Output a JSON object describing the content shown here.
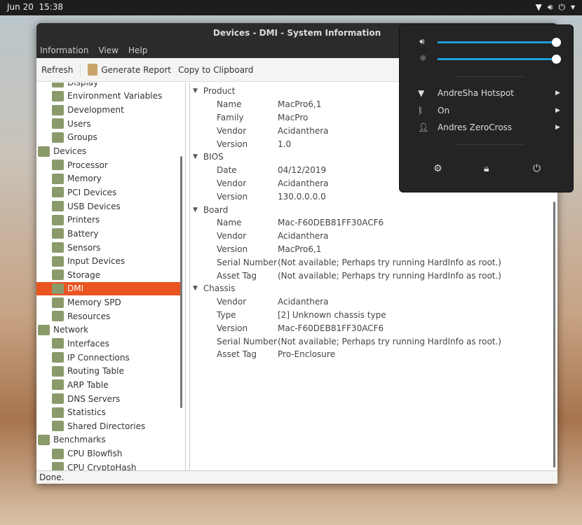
{
  "topbar": {
    "date": "Jun 20",
    "time": "15:38"
  },
  "window": {
    "title": "Devices - DMI - System Information"
  },
  "menu": [
    "Information",
    "View",
    "Help"
  ],
  "toolbar": {
    "refresh": "Refresh",
    "report": "Generate Report",
    "copy": "Copy to Clipboard"
  },
  "sidebar": [
    {
      "label": "Display",
      "cat": false
    },
    {
      "label": "Environment Variables",
      "cat": false
    },
    {
      "label": "Development",
      "cat": false
    },
    {
      "label": "Users",
      "cat": false
    },
    {
      "label": "Groups",
      "cat": false
    },
    {
      "label": "Devices",
      "cat": true
    },
    {
      "label": "Processor",
      "cat": false
    },
    {
      "label": "Memory",
      "cat": false
    },
    {
      "label": "PCI Devices",
      "cat": false
    },
    {
      "label": "USB Devices",
      "cat": false
    },
    {
      "label": "Printers",
      "cat": false
    },
    {
      "label": "Battery",
      "cat": false
    },
    {
      "label": "Sensors",
      "cat": false
    },
    {
      "label": "Input Devices",
      "cat": false
    },
    {
      "label": "Storage",
      "cat": false
    },
    {
      "label": "DMI",
      "cat": false,
      "selected": true
    },
    {
      "label": "Memory SPD",
      "cat": false
    },
    {
      "label": "Resources",
      "cat": false
    },
    {
      "label": "Network",
      "cat": true
    },
    {
      "label": "Interfaces",
      "cat": false
    },
    {
      "label": "IP Connections",
      "cat": false
    },
    {
      "label": "Routing Table",
      "cat": false
    },
    {
      "label": "ARP Table",
      "cat": false
    },
    {
      "label": "DNS Servers",
      "cat": false
    },
    {
      "label": "Statistics",
      "cat": false
    },
    {
      "label": "Shared Directories",
      "cat": false
    },
    {
      "label": "Benchmarks",
      "cat": true
    },
    {
      "label": "CPU Blowfish",
      "cat": false
    },
    {
      "label": "CPU CryptoHash",
      "cat": false
    }
  ],
  "details": [
    {
      "section": "Product",
      "rows": [
        [
          "Name",
          "MacPro6,1"
        ],
        [
          "Family",
          "MacPro"
        ],
        [
          "Vendor",
          "Acidanthera"
        ],
        [
          "Version",
          "1.0"
        ]
      ]
    },
    {
      "section": "BIOS",
      "rows": [
        [
          "Date",
          "04/12/2019"
        ],
        [
          "Vendor",
          "Acidanthera"
        ],
        [
          "Version",
          "130.0.0.0.0"
        ]
      ]
    },
    {
      "section": "Board",
      "rows": [
        [
          "Name",
          "Mac-F60DEB81FF30ACF6"
        ],
        [
          "Vendor",
          "Acidanthera"
        ],
        [
          "Version",
          "MacPro6,1"
        ],
        [
          "Serial Number",
          "(Not available; Perhaps try running HardInfo as root.)"
        ],
        [
          "Asset Tag",
          "(Not available; Perhaps try running HardInfo as root.)"
        ]
      ]
    },
    {
      "section": "Chassis",
      "rows": [
        [
          "Vendor",
          "Acidanthera"
        ],
        [
          "Type",
          "[2] Unknown chassis type"
        ],
        [
          "Version",
          "Mac-F60DEB81FF30ACF6"
        ],
        [
          "Serial Number",
          "(Not available; Perhaps try running HardInfo as root.)"
        ],
        [
          "Asset Tag",
          "Pro-Enclosure"
        ]
      ]
    }
  ],
  "status": "Done.",
  "popup": {
    "volume": 1.0,
    "brightness": 1.0,
    "wifi": "AndreSha Hotspot",
    "bluetooth": "On",
    "user": "Andres ZeroCross"
  },
  "colors": {
    "selection": "#e95420",
    "slider": "#1ea0d8"
  }
}
